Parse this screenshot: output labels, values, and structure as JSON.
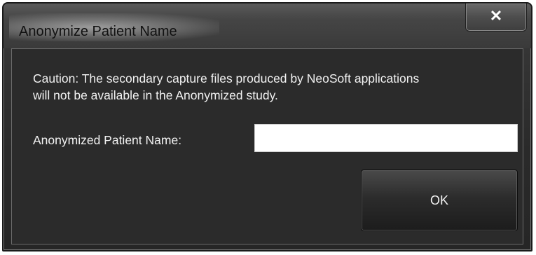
{
  "dialog": {
    "title": "Anonymize Patient Name",
    "close_label": "✕",
    "caution_line1": "Caution: The secondary capture files produced by NeoSoft applications",
    "caution_line2": "will not be available in the Anonymized study.",
    "name_field": {
      "label": "Anonymized Patient Name:",
      "value": "",
      "placeholder": ""
    },
    "ok_label": "OK"
  },
  "icons": {
    "close": "close-icon"
  }
}
